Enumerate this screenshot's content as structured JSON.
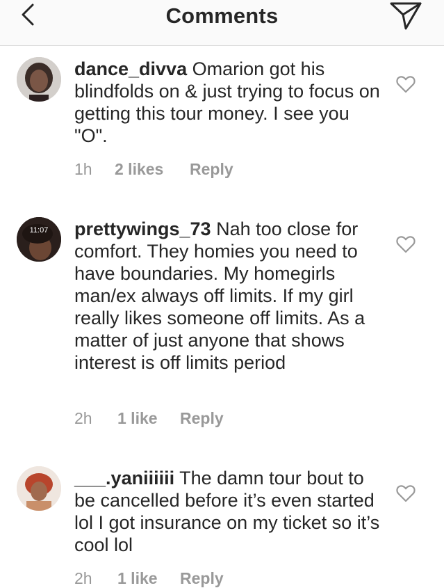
{
  "header": {
    "title": "Comments",
    "back_icon": "chevron-left-icon",
    "share_icon": "paper-plane-icon"
  },
  "comments": [
    {
      "username": "dance_divva",
      "text": "Omarion got his blindfolds on & just trying to focus on getting this tour money. I see you \"O\".",
      "time": "1h",
      "likes": "2 likes",
      "reply": "Reply"
    },
    {
      "username": "prettywings_73",
      "text": "Nah too close for comfort. They homies you need to have boundaries. My homegirls man/ex always off limits. If my girl really likes someone off limits. As a matter of just anyone that shows interest is off limits period",
      "time": "2h",
      "likes": "1 like",
      "reply": "Reply",
      "avatar_lock_time": "11:07"
    },
    {
      "username": "___.yaniiiiii",
      "text": "The damn tour bout to be cancelled before it’s even started lol I got insurance on my ticket so it’s cool lol",
      "time": "2h",
      "likes": "1 like",
      "reply": "Reply"
    }
  ],
  "colors": {
    "text": "#262626",
    "meta": "#999999",
    "header_bg": "#fafafa",
    "divider": "#dbdbdb"
  }
}
